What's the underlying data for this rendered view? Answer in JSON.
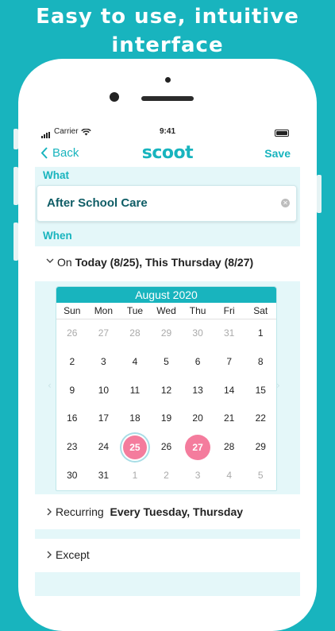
{
  "headline": {
    "line1": "Easy to use, intuitive",
    "line2": "interface"
  },
  "status_bar": {
    "carrier": "Carrier",
    "time": "9:41"
  },
  "nav": {
    "back_label": "Back",
    "logo": "scoot",
    "save_label": "Save"
  },
  "what": {
    "label": "What",
    "value": "After School Care"
  },
  "when": {
    "label": "When",
    "on_prefix": "On",
    "on_value": "Today (8/25), This Thursday (8/27)"
  },
  "calendar": {
    "month": "August 2020",
    "days_of_week": [
      "Sun",
      "Mon",
      "Tue",
      "Wed",
      "Thu",
      "Fri",
      "Sat"
    ],
    "weeks": [
      [
        "26",
        "27",
        "28",
        "29",
        "30",
        "31",
        "1"
      ],
      [
        "2",
        "3",
        "4",
        "5",
        "6",
        "7",
        "8"
      ],
      [
        "9",
        "10",
        "11",
        "12",
        "13",
        "14",
        "15"
      ],
      [
        "16",
        "17",
        "18",
        "19",
        "20",
        "21",
        "22"
      ],
      [
        "23",
        "24",
        "25",
        "26",
        "27",
        "28",
        "29"
      ],
      [
        "30",
        "31",
        "1",
        "2",
        "3",
        "4",
        "5"
      ]
    ],
    "today": "25",
    "selected": [
      "25",
      "27"
    ],
    "accent_color": "#18b4be",
    "selected_color": "#f47c9d"
  },
  "recurring": {
    "label": "Recurring",
    "value": "Every Tuesday, Thursday"
  },
  "except": {
    "label": "Except"
  }
}
